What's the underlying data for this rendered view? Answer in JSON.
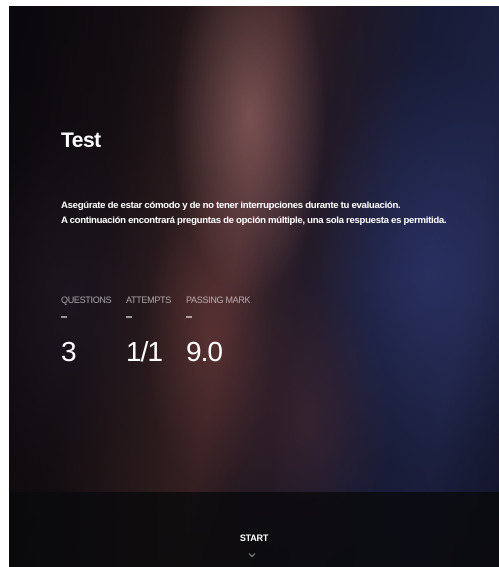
{
  "test": {
    "title": "Test",
    "description_lines": [
      "Asegúrate de estar cómodo y de no tener interrupciones durante tu evaluación.",
      "A continuación encontrará preguntas de opción múltiple, una sola respuesta es permitida."
    ]
  },
  "stats": [
    {
      "label": "QUESTIONS",
      "value": "3"
    },
    {
      "label": "ATTEMPTS",
      "value": "1/1"
    },
    {
      "label": "PASSING MARK",
      "value": "9.0"
    }
  ],
  "footer": {
    "start_label": "START",
    "chevron_icon": "chevron-down-icon"
  },
  "colors": {
    "text": "#ffffff",
    "footer_bg": "#0a0a0c"
  }
}
